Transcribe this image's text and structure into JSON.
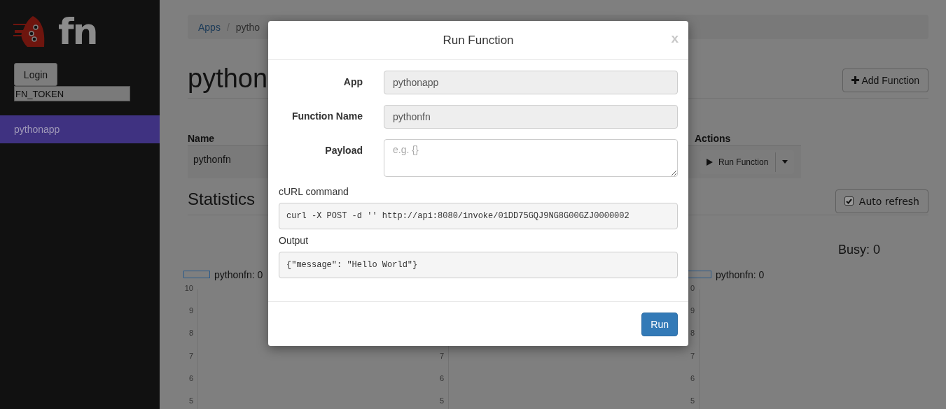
{
  "sidebar": {
    "logo_text": "fn",
    "login_button": "Login",
    "token_field": {
      "value": "FN_TOKEN"
    },
    "items": [
      {
        "label": "pythonapp",
        "selected": true
      }
    ]
  },
  "breadcrumb": [
    {
      "label": "Apps",
      "kind": "link"
    },
    {
      "label": "/",
      "kind": "separator"
    },
    {
      "label": "pytho",
      "kind": "current"
    }
  ],
  "page_title": "python",
  "add_button": "Add Function",
  "table": {
    "columns": [
      "Name",
      "Actions"
    ],
    "rows": [
      {
        "name": "pythonfn",
        "action": "Run Function"
      }
    ]
  },
  "statistics": {
    "title": "Statistics",
    "auto_refresh": {
      "label": "Auto refresh",
      "checked": true
    },
    "charts": [
      {
        "legend": "pythonfn: 0",
        "ticks": [
          "10",
          "9",
          "8",
          "7",
          "6",
          "5"
        ]
      },
      {
        "ticks": [
          "7",
          "6",
          "5"
        ]
      },
      {
        "title": "Busy: 0",
        "legend": "pythonfn: 0",
        "ticks": [
          "0",
          "9",
          "8",
          "7",
          "6",
          "5"
        ]
      }
    ]
  },
  "modal": {
    "title": "Run Function",
    "close": "x",
    "fields": [
      {
        "label": "App",
        "kind": "readonly",
        "value": "pythonapp"
      },
      {
        "label": "Function Name",
        "kind": "readonly",
        "value": "pythonfn"
      },
      {
        "label": "Payload",
        "kind": "textarea",
        "placeholder": "e.g. {}"
      }
    ],
    "outputs": [
      {
        "label": "cURL command",
        "value": "curl -X POST -d '' http://api:8080/invoke/01DD75GQJ9NG8G00GZJ0000002"
      },
      {
        "label": "Output",
        "value": "{\"message\": \"Hello World\"}"
      }
    ],
    "run_button": "Run"
  }
}
